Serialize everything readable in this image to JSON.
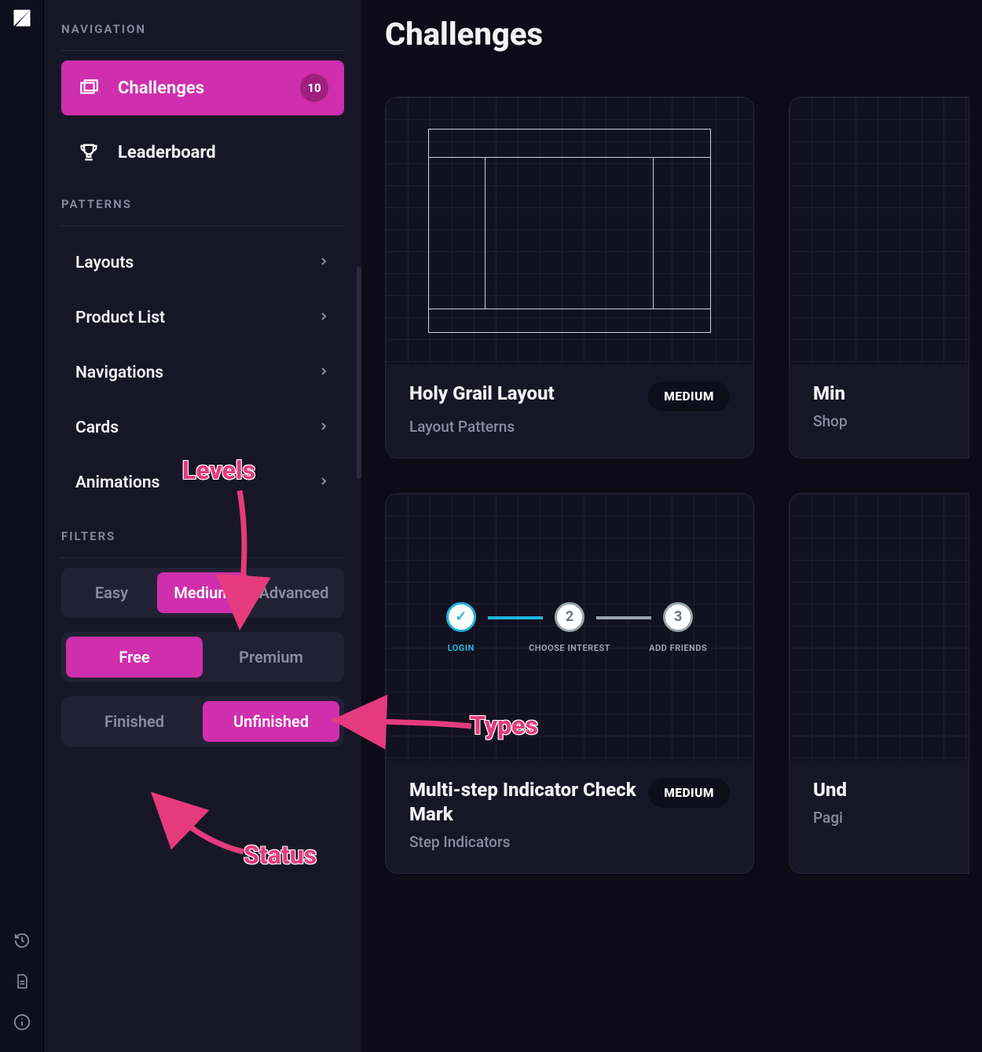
{
  "page": {
    "title": "Challenges"
  },
  "sidebar": {
    "section_navigation": "NAVIGATION",
    "section_patterns": "PATTERNS",
    "section_filters": "FILTERS",
    "nav": {
      "challenges": {
        "label": "Challenges",
        "count": "10"
      },
      "leaderboard": {
        "label": "Leaderboard"
      }
    },
    "patterns": {
      "layouts": "Layouts",
      "product_list": "Product List",
      "navigations": "Navigations",
      "cards": "Cards",
      "animations": "Animations"
    },
    "filters": {
      "levels": {
        "easy": "Easy",
        "medium": "Medium",
        "advanced": "Advanced"
      },
      "types": {
        "free": "Free",
        "premium": "Premium"
      },
      "status": {
        "finished": "Finished",
        "unfinished": "Unfinished"
      }
    }
  },
  "cards": {
    "c1": {
      "title": "Holy Grail Layout",
      "subtitle": "Layout Patterns",
      "difficulty": "MEDIUM"
    },
    "c2": {
      "title": "Multi-step Indicator Check Mark",
      "subtitle": "Step Indicators",
      "difficulty": "MEDIUM"
    },
    "p1": {
      "title": "Min",
      "subtitle": "Shop"
    },
    "p2": {
      "title": "Und",
      "subtitle": "Pagi"
    }
  },
  "steps": {
    "s1": "LOGIN",
    "s2": "CHOOSE INTEREST",
    "s3": "ADD FRIENDS",
    "n2": "2",
    "n3": "3"
  },
  "annotations": {
    "levels": "Levels",
    "types": "Types",
    "status": "Status"
  }
}
